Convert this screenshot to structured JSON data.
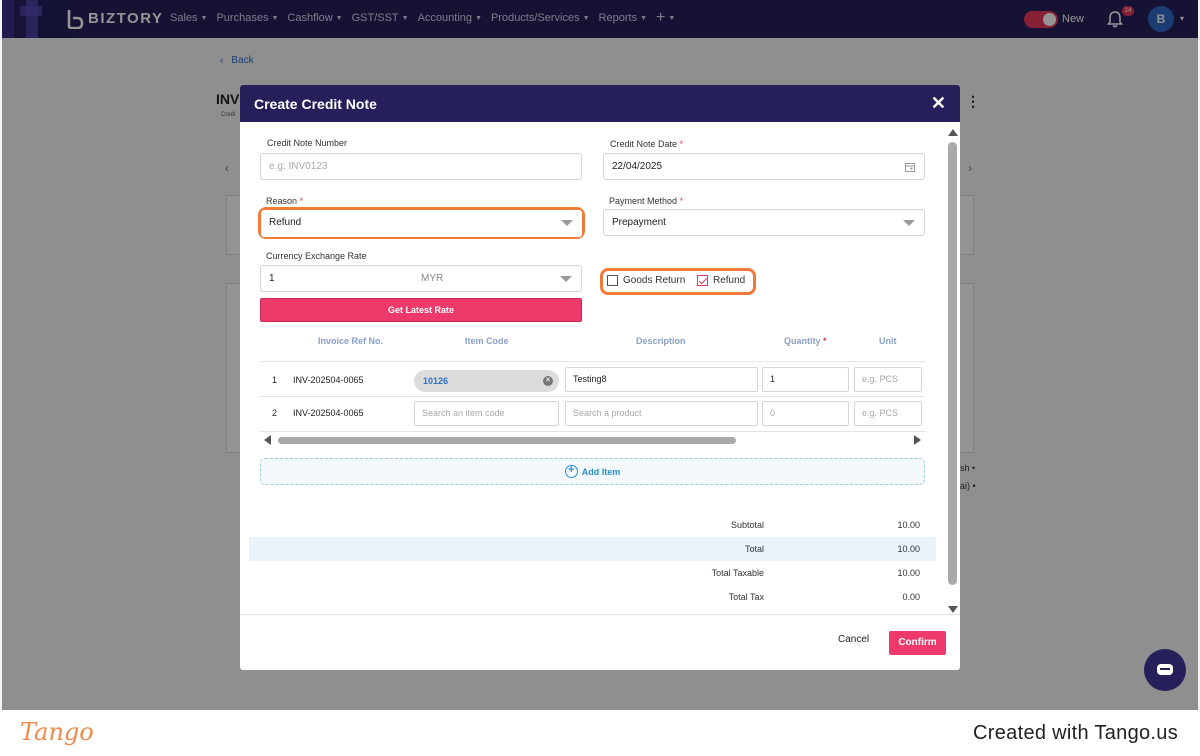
{
  "nav": {
    "brand": "BIZTORY",
    "items": [
      {
        "label": "Sales"
      },
      {
        "label": "Purchases"
      },
      {
        "label": "Cashflow"
      },
      {
        "label": "GST/SST"
      },
      {
        "label": "Accounting"
      },
      {
        "label": "Products/Services"
      },
      {
        "label": "Reports"
      }
    ],
    "toggle_label": "New",
    "notification_count": "24",
    "avatar_initial": "B"
  },
  "background": {
    "back_label": "Back",
    "title": "INV",
    "subtitle": "Credi",
    "snippet1": "sh •",
    "snippet2": "ai) •"
  },
  "modal": {
    "title": "Create Credit Note",
    "credit_note_number": {
      "label": "Credit Note Number",
      "placeholder": "e.g: INV0123",
      "value": ""
    },
    "credit_note_date": {
      "label": "Credit Note Date",
      "value": "22/04/2025"
    },
    "reason": {
      "label": "Reason",
      "value": "Refund"
    },
    "payment_method": {
      "label": "Payment Method",
      "value": "Prepayment"
    },
    "currency_rate": {
      "label": "Currency Exchange Rate",
      "value": "1",
      "unit": "MYR"
    },
    "get_latest_rate": "Get Latest Rate",
    "goods_return": {
      "label": "Goods Return",
      "checked": false
    },
    "refund": {
      "label": "Refund",
      "checked": true
    },
    "table": {
      "headers": [
        "Invoice Ref No.",
        "Item Code",
        "Description",
        "Quantity",
        "Unit"
      ],
      "rows": [
        {
          "no": "1",
          "invoice_ref": "INV-202504-0065",
          "item_code": "10126",
          "description": "Testing8",
          "quantity": "1",
          "unit_placeholder": "e.g. PCS"
        },
        {
          "no": "2",
          "invoice_ref": "INV-202504-0065",
          "item_code_placeholder": "Search an item code",
          "description_placeholder": "Search a product",
          "quantity_placeholder": "0",
          "unit_placeholder": "e.g. PCS"
        }
      ]
    },
    "add_item": "Add Item",
    "summary": [
      {
        "label": "Subtotal",
        "value": "10.00"
      },
      {
        "label": "Total",
        "value": "10.00"
      },
      {
        "label": "Total Taxable",
        "value": "10.00"
      },
      {
        "label": "Total Tax",
        "value": "0.00"
      }
    ],
    "cancel": "Cancel",
    "confirm": "Confirm"
  },
  "footer": {
    "brand": "Tango",
    "created_with": "Created with Tango.us"
  },
  "colors": {
    "nav_bg": "#25205a",
    "accent": "#ee3a6a",
    "highlight": "#f07a3a",
    "link": "#2c6fc7"
  }
}
